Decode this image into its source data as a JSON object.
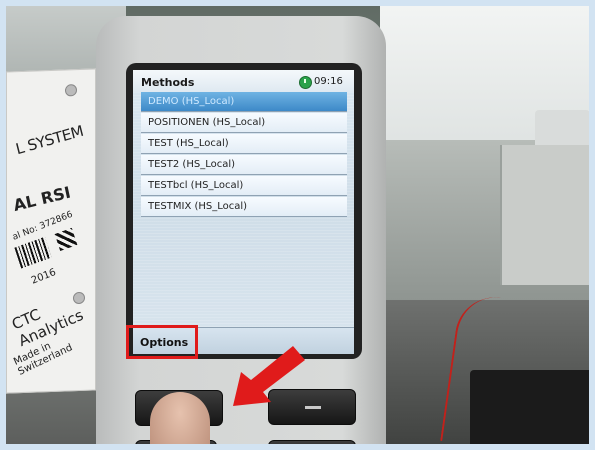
{
  "screen": {
    "title": "Methods",
    "time": "09:16",
    "methods": [
      {
        "label": "DEMO (HS_Local)",
        "selected": true
      },
      {
        "label": "POSITIONEN (HS_Local)",
        "selected": false
      },
      {
        "label": "TEST (HS_Local)",
        "selected": false
      },
      {
        "label": "TEST2 (HS_Local)",
        "selected": false
      },
      {
        "label": "TESTbcl (HS_Local)",
        "selected": false
      },
      {
        "label": "TESTMIX (HS_Local)",
        "selected": false
      }
    ],
    "softkey_left": "Options"
  },
  "label_panel": {
    "line1": "L SYSTEM",
    "line2": "AL RSI",
    "line3": "al No: 372866",
    "line4": "2016",
    "line5": "CTC Analytics",
    "line6": "Made in Switzerland"
  },
  "colors": {
    "highlight_red": "#e01b1b",
    "selection_blue": "#3d89c8",
    "clock_green": "#2aa24a"
  }
}
